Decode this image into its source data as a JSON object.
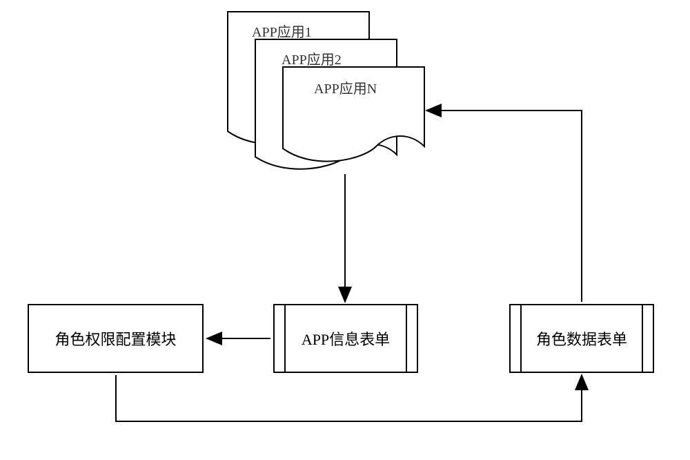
{
  "stack": {
    "item1": "APP应用1",
    "item2": "APP应用2",
    "itemN": "APP应用N"
  },
  "boxes": {
    "role_permission_config": "角色权限配置模块",
    "app_info_form": "APP信息表单",
    "role_data_form": "角色数据表单"
  }
}
